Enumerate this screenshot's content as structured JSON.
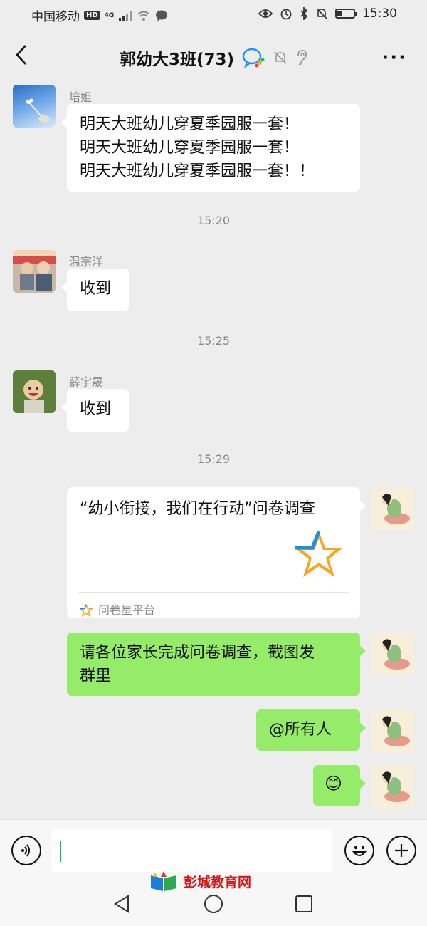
{
  "status_bar": {
    "carrier": "中国移动",
    "hd_badge": "HD",
    "network": "4G",
    "time": "15:30"
  },
  "header": {
    "title": "郭幼大3班(73)"
  },
  "messages": [
    {
      "sender": "培姐",
      "lines": [
        "明天大班幼儿穿夏季园服一套！",
        "明天大班幼儿穿夏季园服一套！",
        "明天大班幼儿穿夏季园服一套！！"
      ]
    },
    {
      "time": "15:20"
    },
    {
      "sender": "温宗洋",
      "text": "收到"
    },
    {
      "time": "15:25"
    },
    {
      "sender": "薛宇晟",
      "text": "收到"
    },
    {
      "time": "15:29"
    },
    {
      "card_title": "“幼小衔接，我们在行动”问卷调查",
      "card_source": "问卷星平台",
      "card_icon": "star-icon"
    },
    {
      "text_lines": [
        "请各位家长完成问卷调查，截图发",
        "群里"
      ]
    },
    {
      "text": "@所有人"
    },
    {
      "emoji": "😊"
    }
  ],
  "watermark": {
    "text": "彭城教育网"
  },
  "colors": {
    "background": "#ededed",
    "my_bubble": "#95ec69",
    "other_bubble": "#ffffff",
    "accent": "#07c160",
    "watermark": "#d01818"
  }
}
